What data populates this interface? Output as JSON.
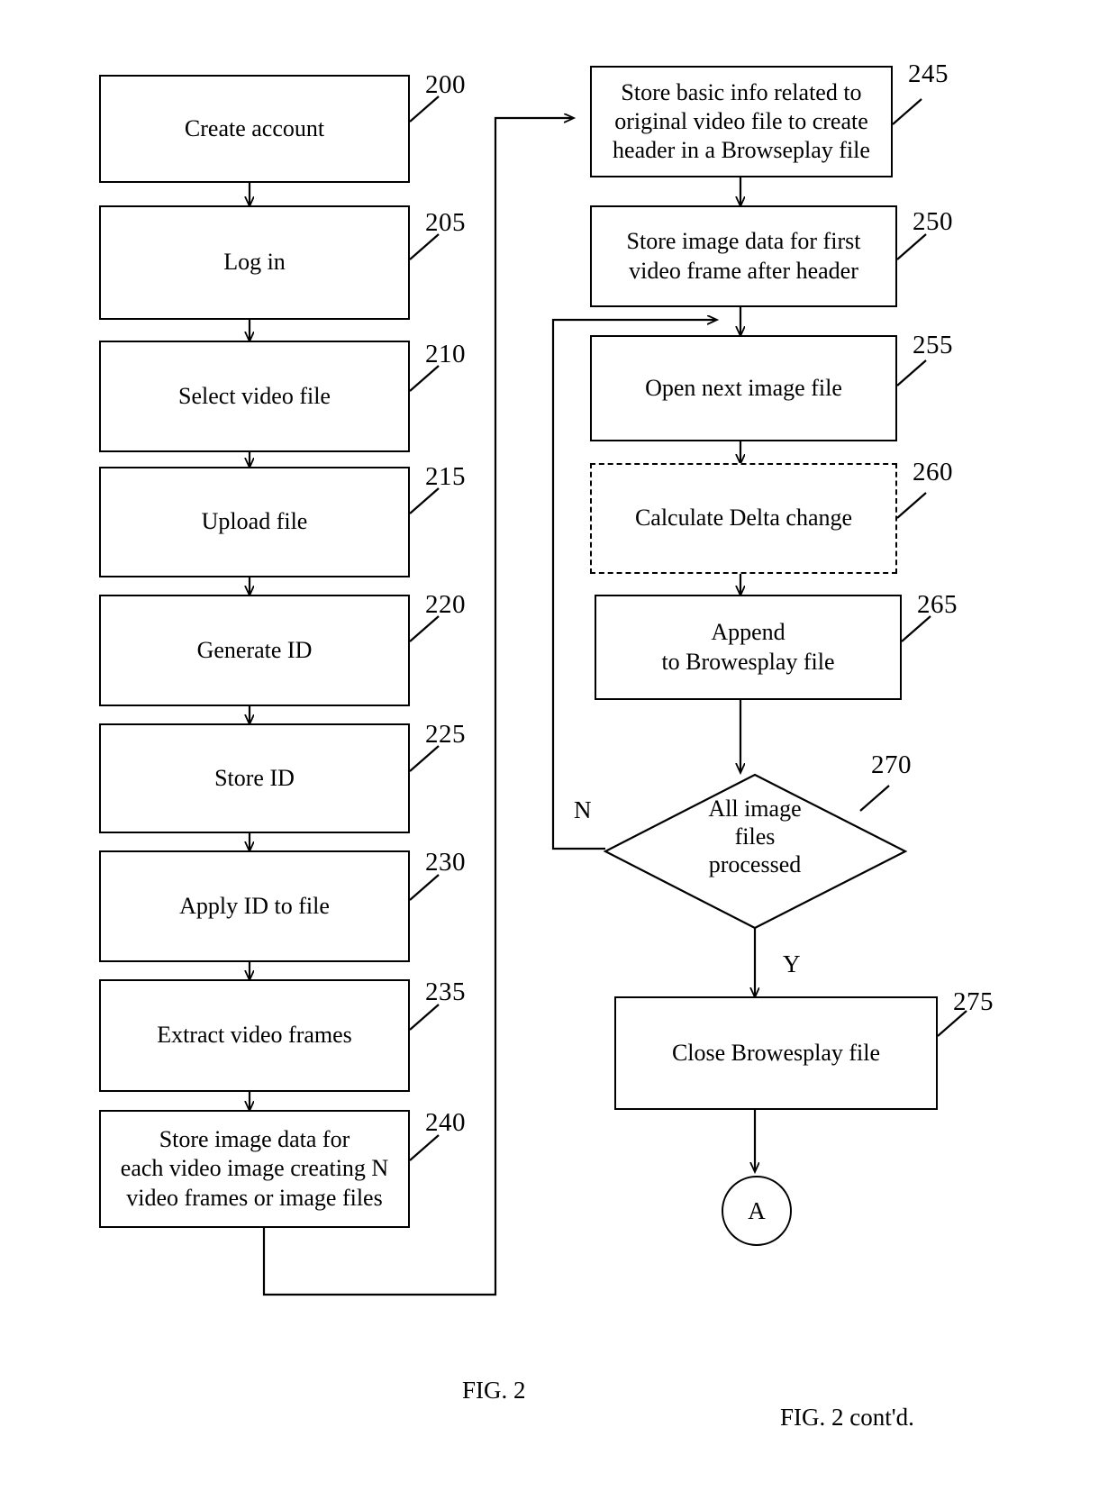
{
  "figure": {
    "caption_left": "FIG. 2",
    "caption_right": "FIG. 2 cont'd."
  },
  "left_column": {
    "steps": [
      {
        "ref": "200",
        "text": "Create account"
      },
      {
        "ref": "205",
        "text": "Log in"
      },
      {
        "ref": "210",
        "text": "Select video file"
      },
      {
        "ref": "215",
        "text": "Upload file"
      },
      {
        "ref": "220",
        "text": "Generate ID"
      },
      {
        "ref": "225",
        "text": "Store ID"
      },
      {
        "ref": "230",
        "text": "Apply ID to file"
      },
      {
        "ref": "235",
        "text": "Extract video frames"
      }
    ],
    "step_240": {
      "ref": "240",
      "line1": "Store image data for",
      "line2": "each video image creating N",
      "line3": "video frames or image files"
    }
  },
  "right_column": {
    "step_245": {
      "ref": "245",
      "line1": "Store basic info related to",
      "line2": "original video file to create",
      "line3": "header in a Browseplay file"
    },
    "step_250": {
      "ref": "250",
      "line1": "Store image data for first",
      "line2": "video frame after header"
    },
    "step_255": {
      "ref": "255",
      "text": "Open next image file"
    },
    "step_260": {
      "ref": "260",
      "text": "Calculate Delta change",
      "border": "dashed"
    },
    "step_265": {
      "ref": "265",
      "line1": "Append",
      "line2": "to Browesplay file"
    },
    "decision_270": {
      "ref": "270",
      "line1": "All image",
      "line2": "files",
      "line3": "processed",
      "branch_no": "N",
      "branch_yes": "Y"
    },
    "step_275": {
      "ref": "275",
      "text": "Close Browesplay file"
    },
    "connector_a": {
      "label": "A"
    }
  },
  "style": {
    "stroke": "#000000",
    "background": "#ffffff"
  }
}
